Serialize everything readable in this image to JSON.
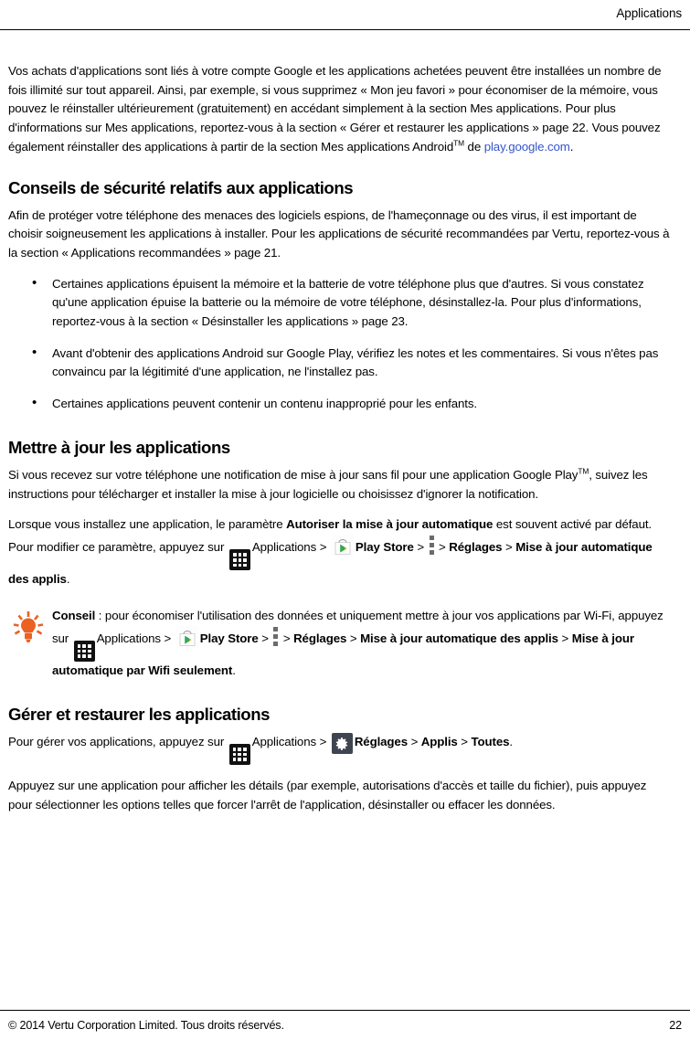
{
  "header": {
    "title": "Applications"
  },
  "intro": {
    "part1": "Vos achats d'applications sont liés à votre compte Google et les applications achetées peuvent être installées un nombre de fois illimité sur tout appareil. Ainsi, par exemple, si vous supprimez « Mon jeu favori » pour économiser de la mémoire, vous pouvez le réinstaller ultérieurement (gratuitement) en accédant simplement à la section Mes applications. Pour plus d'informations sur Mes applications, reportez-vous à la section « Gérer et restaurer les applications » page 22. Vous pouvez également réinstaller des applications à partir de la section Mes applications Android",
    "trademark": "TM",
    "part2": " de ",
    "link_text": "play.google.com",
    "part3": "."
  },
  "security": {
    "heading": "Conseils de sécurité relatifs aux applications",
    "paragraph": "Afin de protéger votre téléphone des menaces des logiciels espions, de l'hameçonnage ou des virus, il est important de choisir soigneusement les applications à installer.  Pour les applications de sécurité recommandées par Vertu, reportez-vous à la section « Applications recommandées » page 21.",
    "bullets": [
      "Certaines applications épuisent la mémoire et la batterie de votre téléphone plus que d'autres. Si vous constatez qu'une application épuise la batterie ou la mémoire de votre téléphone, désinstallez-la. Pour plus d'informations, reportez-vous à la section « Désinstaller les applications » page 23.",
      "Avant d'obtenir des applications Android sur Google Play, vérifiez les notes et les commentaires. Si vous n'êtes pas convaincu par la légitimité d'une application, ne l'installez pas.",
      "Certaines applications peuvent contenir un contenu inapproprié pour les enfants."
    ]
  },
  "update": {
    "heading": "Mettre à jour les applications",
    "paragraph1_a": "Si vous recevez sur votre téléphone une notification de mise à jour sans fil pour une application Google Play",
    "paragraph1_trademark": "TM",
    "paragraph1_b": ", suivez les instructions pour télécharger et installer la mise à jour logicielle ou choisissez d'ignorer la notification.",
    "paragraph2_a": "Lorsque vous installez une application, le paramètre ",
    "paragraph2_bold": "Autoriser la mise à jour automatique",
    "paragraph2_b": " est souvent activé par défaut. Pour modifier ce paramètre, appuyez sur ",
    "path": {
      "apps_label": "Applications",
      "separator": ">",
      "play_store_label": "Play Store",
      "settings_label": "Réglages",
      "auto_update_label": "Mise à jour automatique des applis",
      "period": "."
    }
  },
  "tip": {
    "label": "Conseil",
    "colon": " : ",
    "text_a": "pour économiser l'utilisation des données et uniquement mettre à jour vos applications par Wi-Fi, appuyez sur ",
    "apps_label": "Applications",
    "separator": ">",
    "play_store_label": "Play Store",
    "settings_label": "Réglages",
    "auto_update_label": "Mise à jour automatique des applis",
    "wifi_only_label": "Mise à jour automatique par Wifi seulement",
    "period": "."
  },
  "manage": {
    "heading": "Gérer et restaurer les applications",
    "lead_in": "Pour gérer vos applications, appuyez sur ",
    "apps_label": "Applications",
    "separator": ">",
    "settings_label": "Réglages",
    "apps_menu_label": "Applis",
    "all_label": "Toutes",
    "period": ".",
    "paragraph": "Appuyez sur une application pour afficher les détails (par exemple, autorisations d'accès et taille du fichier), puis appuyez pour sélectionner les options telles que forcer l'arrêt de l'application, désinstaller ou effacer les données."
  },
  "footer": {
    "copyright": "© 2014 Vertu Corporation Limited. Tous droits réservés.",
    "page_number": "22"
  },
  "icons": {
    "apps": "apps-grid-icon",
    "play_store": "play-store-icon",
    "overflow": "overflow-menu-icon",
    "gear": "gear-icon",
    "bulb": "lightbulb-tip-icon"
  },
  "colors": {
    "link": "#3355cc",
    "tip_accent": "#ea6123",
    "apps_icon_bg": "#111111",
    "gear_icon_bg": "#3f4550"
  }
}
